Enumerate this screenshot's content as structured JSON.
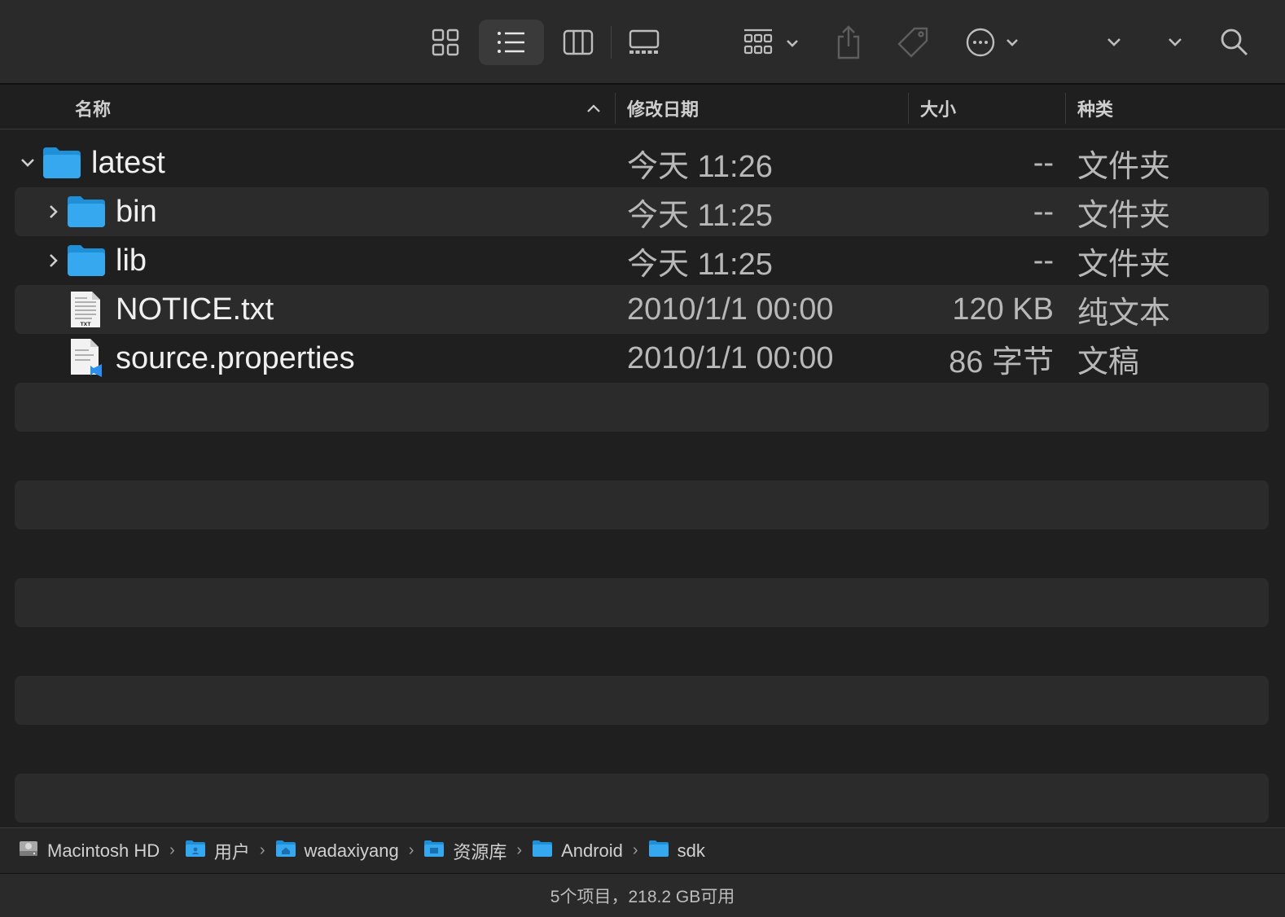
{
  "toolbar": {
    "icons": [
      "icon-view-grid-icon",
      "list-view-icon",
      "column-view-icon",
      "gallery-view-icon",
      "group-icon",
      "share-icon",
      "tag-icon",
      "more-icon",
      "search-icon"
    ],
    "active_view": "list"
  },
  "columns": {
    "name": "名称",
    "date": "修改日期",
    "size": "大小",
    "kind": "种类"
  },
  "rows": [
    {
      "name": "latest",
      "date": "今天 11:26",
      "size": "--",
      "kind": "文件夹",
      "type": "folder",
      "expanded": true,
      "level": 0
    },
    {
      "name": "bin",
      "date": "今天 11:25",
      "size": "--",
      "kind": "文件夹",
      "type": "folder",
      "expanded": false,
      "level": 1
    },
    {
      "name": "lib",
      "date": "今天 11:25",
      "size": "--",
      "kind": "文件夹",
      "type": "folder",
      "expanded": false,
      "level": 1
    },
    {
      "name": "NOTICE.txt",
      "date": "2010/1/1 00:00",
      "size": "120 KB",
      "kind": "纯文本",
      "type": "txt",
      "level": 1
    },
    {
      "name": "source.properties",
      "date": "2010/1/1 00:00",
      "size": "86 字节",
      "kind": "文稿",
      "type": "doc",
      "level": 1
    }
  ],
  "path": [
    {
      "label": "Macintosh HD",
      "icon": "hard-drive-icon"
    },
    {
      "label": "用户",
      "icon": "users-folder-icon"
    },
    {
      "label": "wadaxiyang",
      "icon": "home-folder-icon"
    },
    {
      "label": "资源库",
      "icon": "library-folder-icon"
    },
    {
      "label": "Android",
      "icon": "folder-icon"
    },
    {
      "label": "sdk",
      "icon": "folder-icon"
    }
  ],
  "status": "5个项目，218.2 GB可用",
  "colors": {
    "folder": "#35a8f0",
    "folder_tab": "#1f8fd8",
    "accent": "#0a84ff"
  }
}
